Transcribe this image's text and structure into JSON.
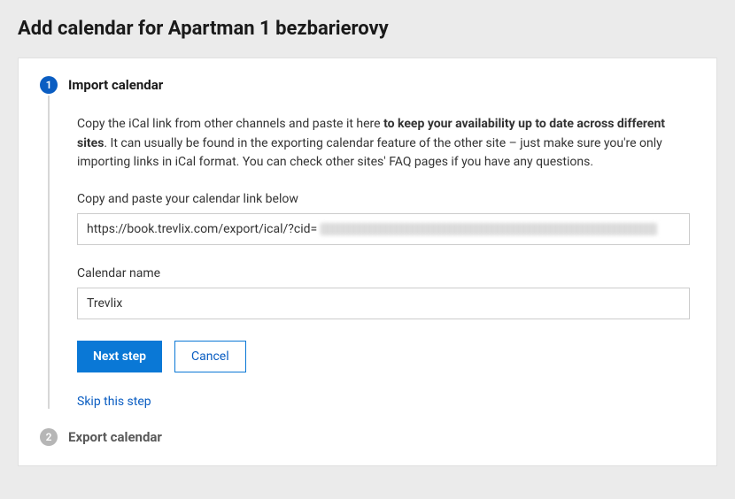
{
  "page": {
    "title": "Add calendar for Apartman 1 bezbarierovy"
  },
  "steps": {
    "import": {
      "number": "1",
      "title": "Import calendar",
      "instruction_pre": "Copy the iCal link from other channels and paste it here ",
      "instruction_bold": "to keep your availability up to date across different sites",
      "instruction_post": ". It can usually be found in the exporting calendar feature of the other site – just make sure you're only importing links in iCal format. You can check other sites' FAQ pages if you have any questions.",
      "link_label": "Copy and paste your calendar link below",
      "link_value_visible": "https://book.trevlix.com/export/ical/?cid=",
      "name_label": "Calendar name",
      "name_value": "Trevlix",
      "next_button": "Next step",
      "cancel_button": "Cancel",
      "skip_link": "Skip this step"
    },
    "export": {
      "number": "2",
      "title": "Export calendar"
    }
  }
}
